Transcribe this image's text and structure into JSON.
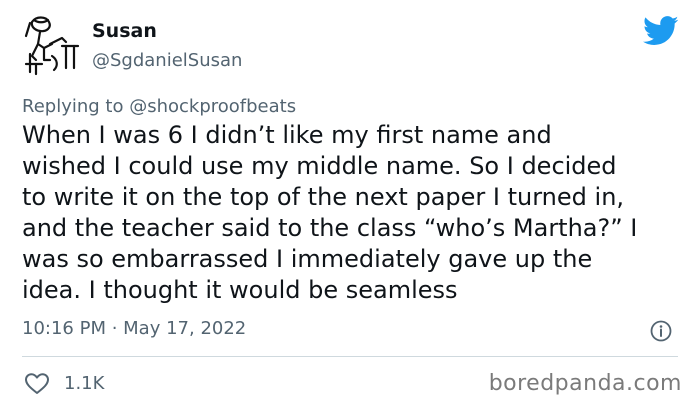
{
  "author": {
    "name": "Susan",
    "handle": "@SgdanielSusan",
    "avatar_icon": "person-at-desk-sketch-icon"
  },
  "reply": {
    "prefix": "Replying to ",
    "mention": "@shockproofbeats"
  },
  "tweet": {
    "lines": [
      "When I was 6 I didn’t like my first name and",
      "wished I could use my middle name. So I decided",
      "to write it on the top of the next paper I turned in,",
      "and the teacher said to the class “who’s Martha?” I",
      "was so embarrassed I immediately gave up the",
      "idea. I thought it would be seamless"
    ]
  },
  "meta": {
    "time": "10:16 PM",
    "separator": " · ",
    "date": "May 17, 2022",
    "info_icon": "info-icon"
  },
  "actions": {
    "like_icon": "heart-icon",
    "like_count": "1.1K"
  },
  "brand": {
    "twitter_icon": "twitter-bird-icon",
    "twitter_color": "#1d9bf0",
    "watermark": "boredpanda.com"
  }
}
